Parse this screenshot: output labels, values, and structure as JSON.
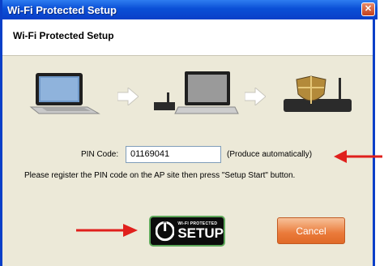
{
  "window": {
    "title": "Wi-Fi Protected Setup"
  },
  "header": {
    "title": "Wi-Fi Protected Setup"
  },
  "pin": {
    "label": "PIN Code:",
    "value": "01169041",
    "note": "(Produce automatically)"
  },
  "instructions": "Please register the PIN code on the AP site then press \"Setup Start\" button.",
  "buttons": {
    "wps_small": "WI-FI PROTECTED",
    "wps_big": "SETUP",
    "cancel": "Cancel"
  },
  "icons": [
    "close-icon",
    "laptop-icon",
    "arrow-right-icon",
    "router-laptop-icon",
    "router-shield-icon",
    "red-arrow-icon",
    "wps-logo-icon"
  ],
  "colors": {
    "titlebar": "#0a4fd6",
    "accent_red": "#e0201c",
    "cancel": "#ea7a3a",
    "wps_green": "#5ea85a"
  }
}
